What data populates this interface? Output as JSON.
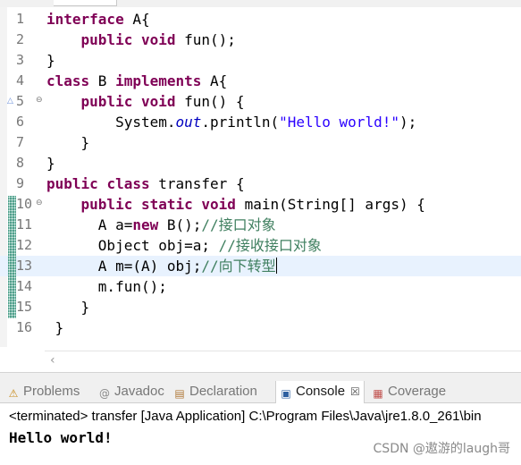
{
  "editor": {
    "lines": [
      {
        "n": "1",
        "tokens": [
          {
            "t": "interface",
            "c": "kw"
          },
          {
            "t": " A{",
            "c": ""
          }
        ]
      },
      {
        "n": "2",
        "tokens": [
          {
            "t": "    ",
            "c": ""
          },
          {
            "t": "public",
            "c": "kw"
          },
          {
            "t": " ",
            "c": ""
          },
          {
            "t": "void",
            "c": "kw"
          },
          {
            "t": " fun();",
            "c": ""
          }
        ]
      },
      {
        "n": "3",
        "tokens": [
          {
            "t": "}",
            "c": ""
          }
        ]
      },
      {
        "n": "4",
        "tokens": [
          {
            "t": "class",
            "c": "kw"
          },
          {
            "t": " B ",
            "c": ""
          },
          {
            "t": "implements",
            "c": "kw"
          },
          {
            "t": " A{",
            "c": ""
          }
        ]
      },
      {
        "n": "5",
        "fold": "⊖",
        "mark": "△",
        "tokens": [
          {
            "t": "    ",
            "c": ""
          },
          {
            "t": "public",
            "c": "kw"
          },
          {
            "t": " ",
            "c": ""
          },
          {
            "t": "void",
            "c": "kw"
          },
          {
            "t": " fun() {",
            "c": ""
          }
        ]
      },
      {
        "n": "6",
        "tokens": [
          {
            "t": "        System.",
            "c": ""
          },
          {
            "t": "out",
            "c": "fld"
          },
          {
            "t": ".println(",
            "c": ""
          },
          {
            "t": "\"Hello world!\"",
            "c": "str"
          },
          {
            "t": ");",
            "c": ""
          }
        ]
      },
      {
        "n": "7",
        "tokens": [
          {
            "t": "    }",
            "c": ""
          }
        ]
      },
      {
        "n": "8",
        "tokens": [
          {
            "t": "}",
            "c": ""
          }
        ]
      },
      {
        "n": "9",
        "tokens": [
          {
            "t": "public",
            "c": "kw"
          },
          {
            "t": " ",
            "c": ""
          },
          {
            "t": "class",
            "c": "kw"
          },
          {
            "t": " transfer {",
            "c": ""
          }
        ]
      },
      {
        "n": "10",
        "fold": "⊖",
        "tokens": [
          {
            "t": "    ",
            "c": ""
          },
          {
            "t": "public",
            "c": "kw"
          },
          {
            "t": " ",
            "c": ""
          },
          {
            "t": "static",
            "c": "kw"
          },
          {
            "t": " ",
            "c": ""
          },
          {
            "t": "void",
            "c": "kw"
          },
          {
            "t": " main(String[] args) {",
            "c": ""
          }
        ]
      },
      {
        "n": "11",
        "tokens": [
          {
            "t": "      A a=",
            "c": ""
          },
          {
            "t": "new",
            "c": "kw"
          },
          {
            "t": " B();",
            "c": ""
          },
          {
            "t": "//接口对象",
            "c": "cmt"
          }
        ]
      },
      {
        "n": "12",
        "tokens": [
          {
            "t": "      Object obj=a; ",
            "c": ""
          },
          {
            "t": "//接收接口对象",
            "c": "cmt"
          }
        ]
      },
      {
        "n": "13",
        "current": true,
        "tokens": [
          {
            "t": "      A m=(A) obj;",
            "c": ""
          },
          {
            "t": "//向下转型",
            "c": "cmt"
          }
        ]
      },
      {
        "n": "14",
        "tokens": [
          {
            "t": "      m.fun();",
            "c": ""
          }
        ]
      },
      {
        "n": "15",
        "tokens": [
          {
            "t": "    }",
            "c": ""
          }
        ]
      },
      {
        "n": "16",
        "tokens": [
          {
            "t": " }",
            "c": ""
          }
        ]
      }
    ]
  },
  "views": {
    "tabs": [
      {
        "label": "Problems",
        "icon": "problems-icon",
        "glyph": "⚠",
        "color": "#c88a1a",
        "active": false
      },
      {
        "label": "Javadoc",
        "icon": "javadoc-icon",
        "glyph": "@",
        "color": "#8a8a8a",
        "active": false
      },
      {
        "label": "Declaration",
        "icon": "declaration-icon",
        "glyph": "▤",
        "color": "#b07a3a",
        "active": false
      },
      {
        "label": "Console",
        "icon": "console-icon",
        "glyph": "▣",
        "color": "#2d5fa0",
        "active": true
      },
      {
        "label": "Coverage",
        "icon": "coverage-icon",
        "glyph": "▦",
        "color": "#c0504d",
        "active": false
      }
    ],
    "close_glyph": "☒"
  },
  "console": {
    "status": "<terminated> transfer [Java Application] C:\\Program Files\\Java\\jre1.8.0_261\\bin",
    "output": "Hello world!"
  },
  "watermark": "CSDN @遨游的laugh哥",
  "colors": {
    "keyword": "#7f0055",
    "string": "#2a00ff",
    "field": "#0000c0",
    "comment": "#3f7f5f",
    "current_line": "#e8f2fe"
  }
}
